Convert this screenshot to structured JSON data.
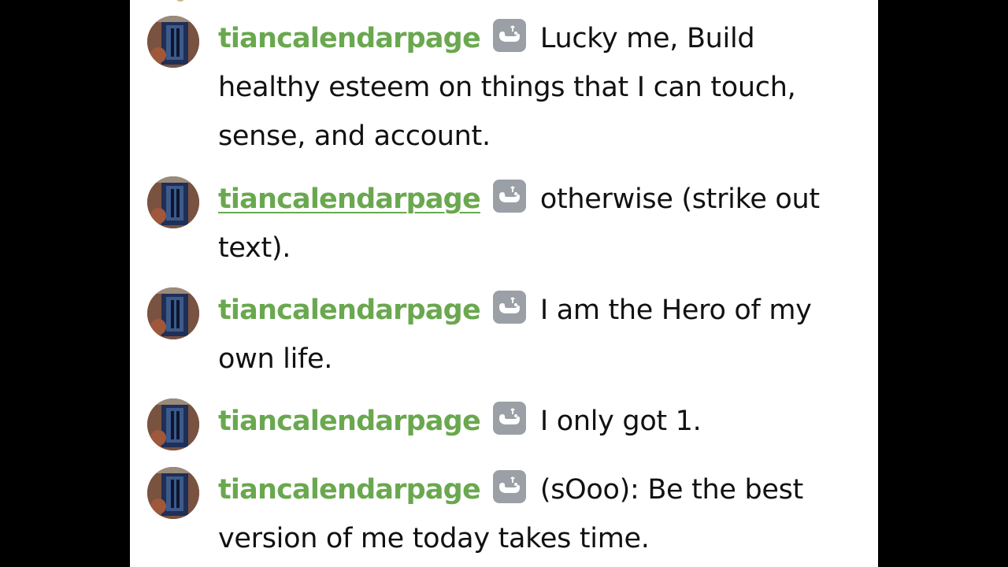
{
  "chat": {
    "messages": [
      {
        "username": "tiancalendarpage",
        "badge_icon": "whale-badge-icon",
        "text": "Lucky me, Build healthy esteem on things that I can touch, sense, and account.",
        "username_hovered": false
      },
      {
        "username": "tiancalendarpage",
        "badge_icon": "whale-badge-icon",
        "text": "otherwise (strike out text).",
        "username_hovered": true
      },
      {
        "username": "tiancalendarpage",
        "badge_icon": "whale-badge-icon",
        "text": "I am the Hero of my own life.",
        "username_hovered": false
      },
      {
        "username": "tiancalendarpage",
        "badge_icon": "whale-badge-icon",
        "text": "I only got 1.",
        "username_hovered": false
      },
      {
        "username": "tiancalendarpage",
        "badge_icon": "whale-badge-icon",
        "text": "(sOoo): Be the best version of me today takes time.",
        "username_hovered": false
      }
    ],
    "colors": {
      "username": "#6aa84f",
      "badge_bg": "#9aa0a6",
      "text": "#111111",
      "background": "#ffffff",
      "letterbox": "#000000"
    }
  }
}
